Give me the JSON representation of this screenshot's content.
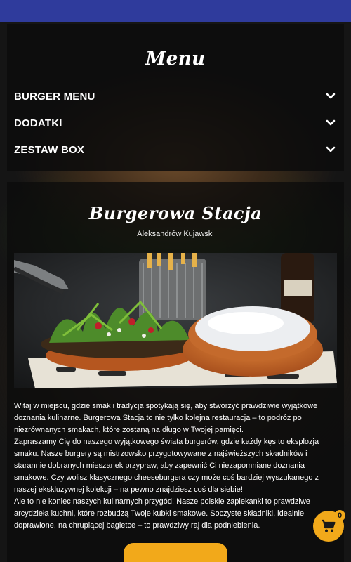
{
  "menu": {
    "title": "Menu",
    "items": [
      {
        "label": "BURGER MENU",
        "icon": "chevron-down-icon"
      },
      {
        "label": "DODATKI",
        "icon": "chevron-down-icon"
      },
      {
        "label": "ZESTAW BOX",
        "icon": "chevron-down-icon"
      }
    ]
  },
  "restaurant": {
    "name": "Burgerowa Stacja",
    "location": "Aleksandrów Kujawski",
    "description": [
      "Witaj w miejscu, gdzie smak i tradycja spotykają się, aby stworzyć prawdziwie wyjątkowe doznania kulinarne. Burgerowa Stacja to nie tylko kolejna restauracja – to podróż po niezrównanych smakach, które zostaną na długo w Twojej pamięci.",
      "Zapraszamy Cię do naszego wyjątkowego świata burgerów, gdzie każdy kęs to eksplozja smaku. Nasze burgery są mistrzowsko przygotowywane z najświeższych składników i starannie dobranych mieszanek przypraw, aby zapewnić Ci niezapomniane doznania smakowe. Czy wolisz klasycznego cheeseburgera czy może coś bardziej wyszukanego z naszej ekskluzywnej kolekcji – na pewno znajdziesz coś dla siebie!",
      "Ale to nie koniec naszych kulinarnych przygód! Nasze polskie zapiekanki to prawdziwe arcydzieła kuchni, które rozbudzą Twoje kubki smakowe. Soczyste składniki, idealnie doprawione, na chrupiącej bagietce – to prawdziwy raj dla podniebienia."
    ]
  },
  "cart": {
    "count": "0",
    "icon": "shopping-cart-icon"
  },
  "colors": {
    "header": "#2f3b9c",
    "accent": "#f2a91a"
  }
}
